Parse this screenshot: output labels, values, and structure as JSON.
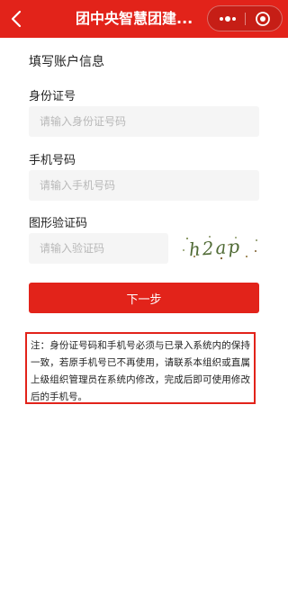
{
  "nav": {
    "title": "团中央智慧团建...",
    "back_icon": "chevron-left-icon",
    "more_icon": "more-dots-icon",
    "close_icon": "target-close-icon",
    "bar_color": "#e2231a"
  },
  "form": {
    "section_title": "填写账户信息",
    "id_label": "身份证号",
    "id_placeholder": "请输入身份证号码",
    "phone_label": "手机号码",
    "phone_placeholder": "请输入手机号码",
    "captcha_label": "图形验证码",
    "captcha_placeholder": "请输入验证码",
    "captcha_text": "h2ap",
    "next_label": "下一步"
  },
  "note": {
    "text": "注：身份证号码和手机号必须与已录入系统内的保持一致，若原手机号已不再使用，请联系本组织或直属上级组织管理员在系统内修改，完成后即可使用修改后的手机号。"
  }
}
